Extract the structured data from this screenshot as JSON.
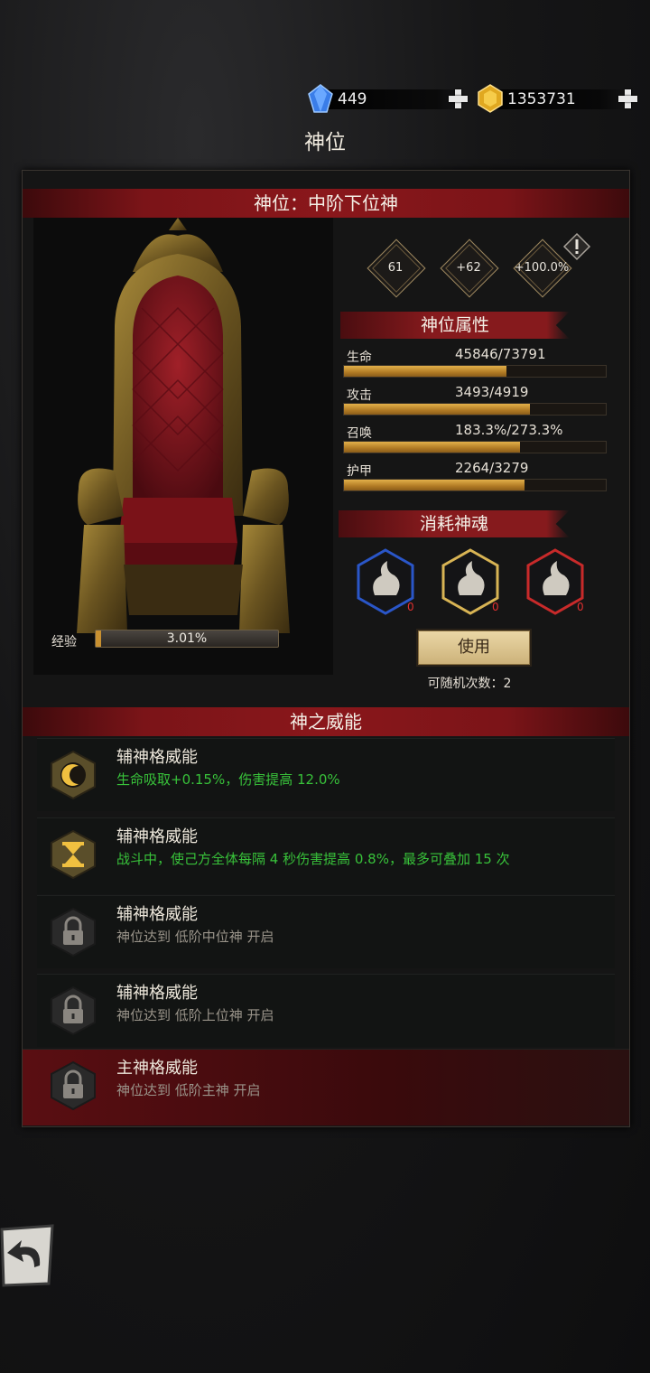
{
  "topbar": {
    "gems": "449",
    "gold": "1353731",
    "title": "神位"
  },
  "panel": {
    "rank_banner": "神位：中阶下位神",
    "stats": [
      "61",
      "+62",
      "+100.0%"
    ],
    "attr_title": "神位属性",
    "attributes": [
      {
        "label": "生命",
        "value": "45846/73791",
        "fill": 0.621
      },
      {
        "label": "攻击",
        "value": "3493/4919",
        "fill": 0.71
      },
      {
        "label": "召唤",
        "value": "183.3%/273.3%",
        "fill": 0.671
      },
      {
        "label": "护甲",
        "value": "2264/3279",
        "fill": 0.69
      }
    ],
    "soul_title": "消耗神魂",
    "souls": [
      {
        "color": "#2a56c8",
        "count": "0"
      },
      {
        "color": "#c8a44a",
        "count": "0"
      },
      {
        "color": "#c82a2a",
        "count": "0"
      }
    ],
    "use_button": "使用",
    "random_label": "可随机次数：2",
    "exp_label": "经验",
    "exp_value": "3.01%",
    "exp_fill": 0.0301,
    "power_banner": "神之威能",
    "powers": [
      {
        "title": "辅神格威能",
        "desc": "生命吸取+0.15%，伤害提高 12.0%",
        "icon": "moon-icon",
        "locked": false
      },
      {
        "title": "辅神格威能",
        "desc": "战斗中，使己方全体每隔 4 秒伤害提高 0.8%，最多可叠加 15 次",
        "icon": "hourglass-icon",
        "locked": false
      },
      {
        "title": "辅神格威能",
        "desc": "神位达到 低阶中位神 开启",
        "icon": "lock-icon",
        "locked": true
      },
      {
        "title": "辅神格威能",
        "desc": "神位达到 低阶上位神 开启",
        "icon": "lock-icon",
        "locked": true
      },
      {
        "title": "主神格威能",
        "desc": "神位达到 低阶主神 开启",
        "icon": "lock-icon",
        "locked": true
      }
    ]
  }
}
